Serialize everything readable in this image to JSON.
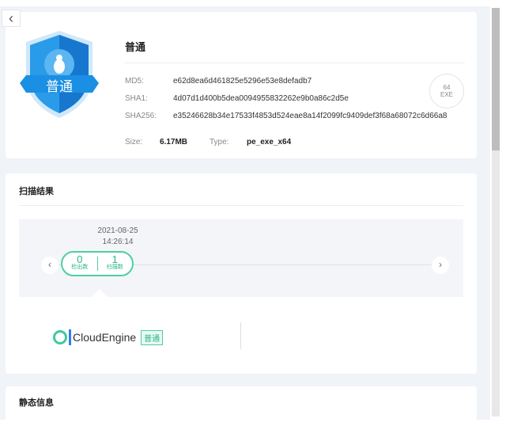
{
  "header": {
    "back_icon": "chevron-left"
  },
  "file": {
    "level": "普通",
    "badge_label": "普通",
    "md5_label": "MD5:",
    "md5": "e62d8ea6d461825e5296e53e8defadb7",
    "sha1_label": "SHA1:",
    "sha1": "4d07d1d400b5dea0094955832262e9b0a86c2d5e",
    "sha256_label": "SHA256:",
    "sha256": "e35246628b34e17533f4853d524eae8a14f2099fc9409def3f68a68072c6d66a8",
    "size_label": "Size:",
    "size": "6.17MB",
    "type_label": "Type:",
    "type": "pe_exe_x64",
    "exe_icon_top": "64",
    "exe_icon_bottom": "EXE"
  },
  "scan": {
    "title": "扫描结果",
    "date": "2021-08-25",
    "time": "14:26:14",
    "detected": "0",
    "detected_label": "检出数",
    "scanned": "1",
    "scanned_label": "扫描数",
    "engine": "CloudEngine",
    "engine_tag": "普通"
  },
  "static": {
    "title": "静态信息"
  },
  "colors": {
    "accent": "#4ccfa1",
    "shield": "#1e90e0"
  }
}
